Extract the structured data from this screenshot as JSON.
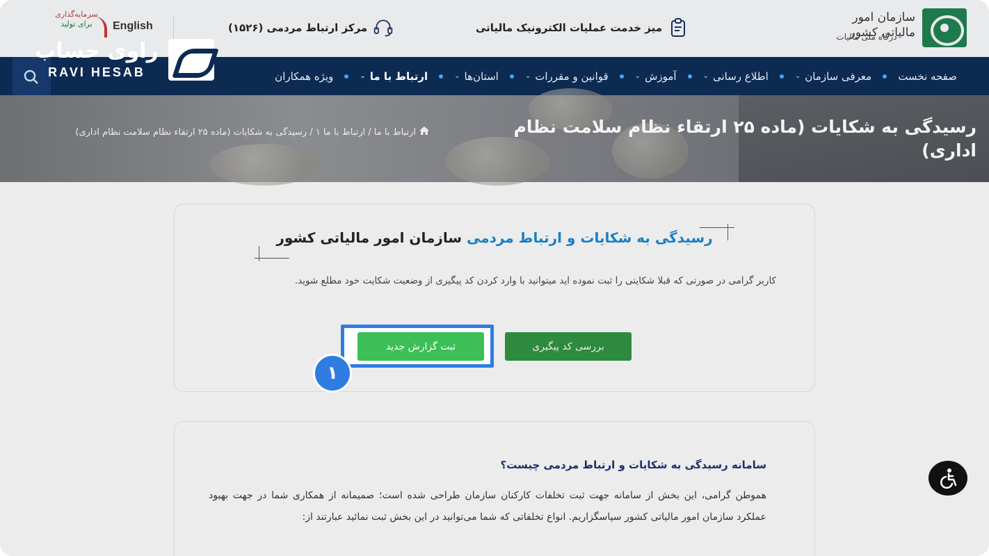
{
  "header": {
    "org_name": "سازمان امور مالیاتی کشور",
    "org_sub": "درگاه ملی مالیات",
    "desk_label": "میز خدمت عملیات الکترونیک مالیاتی",
    "call_label": "مرکز ارتباط مردمی (۱۵۲۶)",
    "language_label": "English",
    "campaign_line1": "سرمایه‌گذاری",
    "campaign_line2": "برای تولید"
  },
  "nav": {
    "items": [
      {
        "label": "صفحه نخست",
        "has_dropdown": false,
        "bold": false
      },
      {
        "label": "معرفی سازمان",
        "has_dropdown": true,
        "bold": false
      },
      {
        "label": "اطلاع رسانی",
        "has_dropdown": true,
        "bold": false
      },
      {
        "label": "آموزش",
        "has_dropdown": true,
        "bold": false
      },
      {
        "label": "قوانین و مقررات",
        "has_dropdown": true,
        "bold": false
      },
      {
        "label": "استان‌ها",
        "has_dropdown": true,
        "bold": false
      },
      {
        "label": "ارتباط با ما",
        "has_dropdown": true,
        "bold": true
      },
      {
        "label": "ویژه همکاران",
        "has_dropdown": false,
        "bold": false
      }
    ]
  },
  "hero": {
    "title": "رسیدگی به شکایات (ماده ۲۵ ارتقاء نظام سلامت نظام اداری)",
    "breadcrumb": "ارتباط با ما / ارتباط با ما ۱ / رسیدگی به شکایات (ماده ۲۵ ارتقاء نظام سلامت نظام اداری)"
  },
  "watermark": {
    "fa": "راوی حساب",
    "en": "RAVI HESAB"
  },
  "complaint_card": {
    "title_highlight": "رسیدگی به شکایات و ارتباط مردمی",
    "title_rest": " سازمان امور مالیاتی کشور",
    "description": "کاربر گرامی در صورتی که قبلا شکایتی را ثبت نموده اید میتوانید با وارد کردن کد پیگیری از وضعیت شکایت خود مطلع شوید.",
    "new_report_button": "ثبت گزارش جدید",
    "track_button": "بررسی کد پیگیری",
    "step_number": "۱"
  },
  "info_section": {
    "heading": "سامانه رسیدگی به شکایات و ارتباط مردمی چیست؟",
    "body": "هموطن گرامی، این بخش از سامانه جهت ثبت تخلفات کارکنان سازمان طراحی شده است؛ صمیمانه از همکاری شما در جهت بهبود عملکرد سازمان امور مالیاتی کشور سپاسگزاریم. انواع تخلفاتی که شما می‌توانید در این بخش ثبت نمائید عبارتند از:"
  },
  "colors": {
    "nav_bg": "#0d2a52",
    "accent_blue": "#1a7fc2",
    "button_green": "#3cbf56",
    "button_dark_green": "#2e8a3e",
    "highlight_blue": "#2f7de1"
  }
}
